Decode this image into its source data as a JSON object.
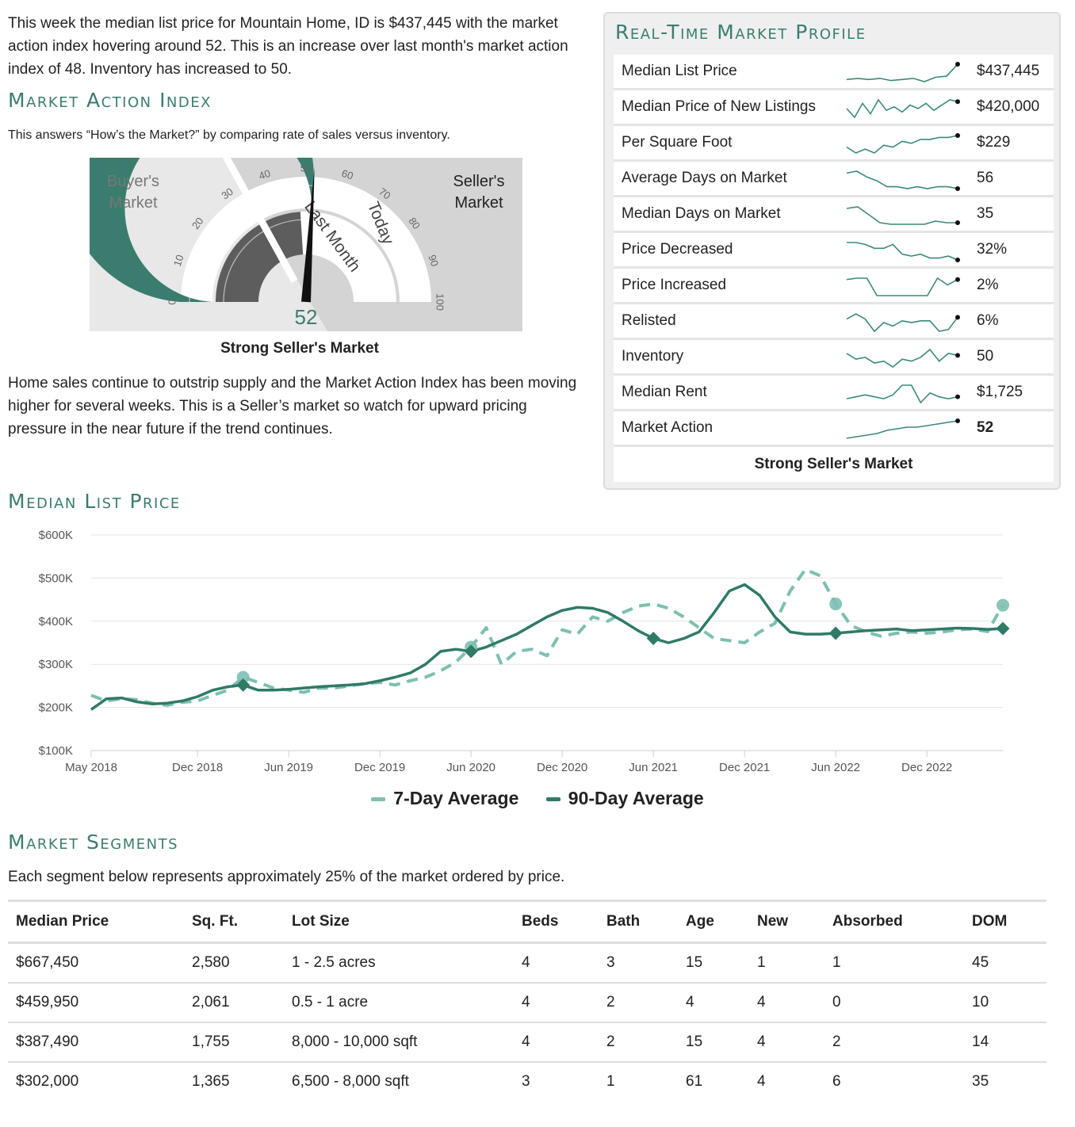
{
  "intro": "This week the median list price for Mountain Home, ID is $437,445 with the market action index hovering around 52. This is an increase over last month's market action index of 48. Inventory has increased to 50.",
  "market_action_index": {
    "title": "Market Action Index",
    "subtitle": "This answers “How’s the Market?” by comparing rate of sales versus inventory.",
    "gauge": {
      "buyers_label": [
        "Buyer's",
        "Market"
      ],
      "sellers_label": [
        "Seller's",
        "Market"
      ],
      "ticks": [
        "0",
        "10",
        "20",
        "30",
        "40",
        "50",
        "60",
        "70",
        "80",
        "90",
        "100"
      ],
      "last_month_label": "Last Month",
      "today_label": "Today",
      "value_text": "52",
      "value": 52,
      "last_month_value": 48
    },
    "verdict": "Strong Seller's Market",
    "summary": "Home sales continue to outstrip supply and the Market Action Index has been moving higher for several weeks. This is a Seller’s market so watch for upward pricing pressure in the near future if the trend continues."
  },
  "profile": {
    "title": "Real-Time Market Profile",
    "rows": [
      {
        "label": "Median List Price",
        "value": "$437,445",
        "bold": false,
        "trend": [
          4,
          5,
          4,
          5,
          3,
          4,
          5,
          2,
          6,
          7,
          18
        ]
      },
      {
        "label": "Median Price of New Listings",
        "value": "$420,000",
        "bold": false,
        "trend": [
          6,
          1,
          9,
          3,
          11,
          5,
          7,
          4,
          8,
          6,
          9,
          5,
          8,
          11,
          10
        ]
      },
      {
        "label": "Per Square Foot",
        "value": "$229",
        "bold": false,
        "trend": [
          4,
          1,
          3,
          1,
          5,
          4,
          7,
          6,
          8,
          8,
          9,
          9,
          10
        ]
      },
      {
        "label": "Average Days on Market",
        "value": "56",
        "bold": false,
        "trend": [
          10,
          11,
          8,
          6,
          3,
          3,
          2,
          3,
          2,
          3,
          3,
          2
        ]
      },
      {
        "label": "Median Days on Market",
        "value": "35",
        "bold": false,
        "trend": [
          12,
          13,
          8,
          3,
          2,
          2,
          2,
          2,
          4,
          3,
          3
        ]
      },
      {
        "label": "Price Decreased",
        "value": "32%",
        "bold": false,
        "trend": [
          10,
          10,
          9,
          7,
          7,
          9,
          4,
          3,
          4,
          2,
          2,
          3,
          1
        ]
      },
      {
        "label": "Price Increased",
        "value": "2%",
        "bold": false,
        "trend": [
          13,
          14,
          14,
          1,
          1,
          1,
          1,
          1,
          1,
          14,
          9,
          13
        ]
      },
      {
        "label": "Relisted",
        "value": "6%",
        "bold": false,
        "trend": [
          9,
          12,
          9,
          2,
          7,
          5,
          8,
          7,
          8,
          8,
          2,
          3,
          10
        ]
      },
      {
        "label": "Inventory",
        "value": "50",
        "bold": false,
        "trend": [
          10,
          7,
          8,
          5,
          6,
          3,
          7,
          6,
          8,
          12,
          6,
          10,
          9
        ]
      },
      {
        "label": "Median Rent",
        "value": "$1,725",
        "bold": false,
        "trend": [
          4,
          5,
          6,
          5,
          4,
          6,
          11,
          11,
          2,
          7,
          5,
          4,
          5
        ]
      },
      {
        "label": "Market Action",
        "value": "52",
        "bold": true,
        "trend": [
          1,
          2,
          3,
          4,
          6,
          7,
          8,
          8,
          9,
          10,
          11,
          12
        ]
      }
    ],
    "verdict": "Strong Seller's Market"
  },
  "median_list_price": {
    "title": "Median List Price",
    "chart_data": {
      "type": "line",
      "y_ticks": [
        "$600K",
        "$500K",
        "$400K",
        "$300K",
        "$200K",
        "$100K"
      ],
      "ylim": [
        100000,
        600000
      ],
      "x_ticks": [
        "May 2018",
        "Dec 2018",
        "Jun 2019",
        "Dec 2019",
        "Jun 2020",
        "Dec 2020",
        "Jun 2021",
        "Dec 2021",
        "Jun 2022",
        "Dec 2022"
      ],
      "x_tick_index": [
        0,
        7,
        13,
        19,
        25,
        31,
        37,
        43,
        49,
        55
      ],
      "x_count": 61,
      "grid": true,
      "legend": "bottom",
      "series": [
        {
          "name": "7-Day Average",
          "color": "#7dbfb1",
          "values": [
            228000,
            215000,
            220000,
            218000,
            210000,
            205000,
            212000,
            215000,
            228000,
            240000,
            270000,
            258000,
            245000,
            240000,
            235000,
            245000,
            245000,
            250000,
            255000,
            258000,
            252000,
            262000,
            270000,
            285000,
            305000,
            340000,
            385000,
            300000,
            330000,
            335000,
            320000,
            380000,
            370000,
            410000,
            400000,
            420000,
            435000,
            440000,
            430000,
            410000,
            385000,
            360000,
            355000,
            350000,
            375000,
            395000,
            470000,
            520000,
            505000,
            440000,
            390000,
            375000,
            365000,
            372000,
            375000,
            372000,
            375000,
            380000,
            382000,
            376000,
            437000
          ]
        },
        {
          "name": "90-Day Average",
          "color": "#2f7a68",
          "values": [
            195000,
            220000,
            222000,
            213000,
            208000,
            210000,
            215000,
            225000,
            240000,
            248000,
            252000,
            240000,
            240000,
            242000,
            245000,
            248000,
            250000,
            252000,
            255000,
            262000,
            270000,
            280000,
            300000,
            330000,
            335000,
            330000,
            340000,
            355000,
            370000,
            390000,
            410000,
            425000,
            432000,
            430000,
            420000,
            400000,
            378000,
            360000,
            350000,
            360000,
            375000,
            420000,
            470000,
            485000,
            460000,
            410000,
            375000,
            370000,
            370000,
            372000,
            375000,
            378000,
            380000,
            382000,
            378000,
            380000,
            382000,
            384000,
            383000,
            381000,
            383000
          ]
        }
      ],
      "markers": {
        "90-Day Average": [
          10,
          25,
          37,
          49,
          60
        ],
        "7-Day Average": [
          10,
          25,
          49,
          60
        ]
      }
    }
  },
  "segments": {
    "title": "Market Segments",
    "subtitle": "Each segment below represents approximately 25% of the market ordered by price.",
    "headers": [
      "Median Price",
      "Sq. Ft.",
      "Lot Size",
      "Beds",
      "Bath",
      "Age",
      "New",
      "Absorbed",
      "DOM"
    ],
    "rows": [
      [
        "$667,450",
        "2,580",
        "1 - 2.5 acres",
        "4",
        "3",
        "15",
        "1",
        "1",
        "45"
      ],
      [
        "$459,950",
        "2,061",
        "0.5 - 1 acre",
        "4",
        "2",
        "4",
        "4",
        "0",
        "10"
      ],
      [
        "$387,490",
        "1,755",
        "8,000 - 10,000 sqft",
        "4",
        "2",
        "15",
        "4",
        "2",
        "14"
      ],
      [
        "$302,000",
        "1,365",
        "6,500 - 8,000 sqft",
        "3",
        "1",
        "61",
        "4",
        "6",
        "35"
      ]
    ]
  }
}
